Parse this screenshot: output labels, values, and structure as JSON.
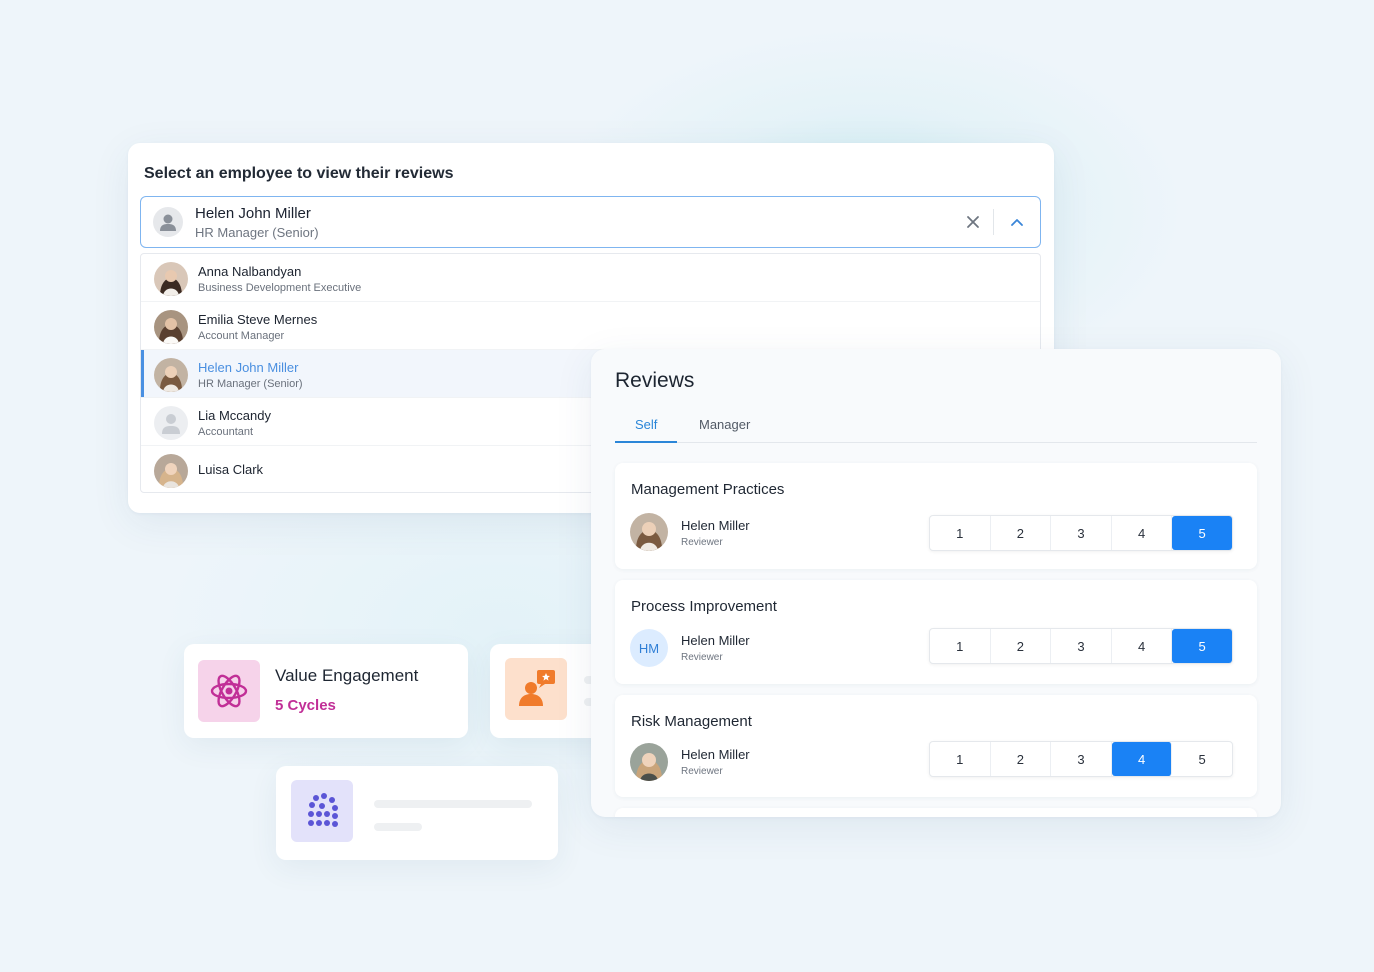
{
  "selector": {
    "title": "Select an employee to view their reviews",
    "selected": {
      "name": "Helen John Miller",
      "role": "HR Manager (Senior)"
    },
    "clear_icon": "close-icon",
    "toggle_icon": "chevron-up-icon",
    "options": [
      {
        "name": "Anna Nalbandyan",
        "role": "Business Development Executive",
        "active": false
      },
      {
        "name": "Emilia Steve Mernes",
        "role": "Account Manager",
        "active": false
      },
      {
        "name": "Helen John Miller",
        "role": "HR Manager (Senior)",
        "active": true
      },
      {
        "name": "Lia Mccandy",
        "role": "Accountant",
        "active": false
      },
      {
        "name": "Luisa Clark",
        "role": "",
        "active": false
      }
    ]
  },
  "reviews": {
    "title": "Reviews",
    "tabs": [
      {
        "label": "Self",
        "active": true
      },
      {
        "label": "Manager",
        "active": false
      }
    ],
    "items": [
      {
        "title": "Management Practices",
        "reviewer": "Helen Miller",
        "reviewer_role": "Reviewer",
        "avatar": "photo",
        "rating": 5
      },
      {
        "title": "Process Improvement",
        "reviewer": "Helen Miller",
        "reviewer_role": "Reviewer",
        "avatar": "HM",
        "rating": 5
      },
      {
        "title": "Risk Management",
        "reviewer": "Helen Miller",
        "reviewer_role": "Reviewer",
        "avatar": "photo",
        "rating": 4
      }
    ],
    "scale": [
      "1",
      "2",
      "3",
      "4",
      "5"
    ]
  },
  "value_engagement": {
    "title": "Value Engagement",
    "subtitle": "5 Cycles",
    "icon": "atom-icon"
  },
  "feedback_card": {
    "icon": "person-feedback-icon"
  },
  "bubbles_card": {
    "icon": "people-cluster-icon"
  },
  "colors": {
    "accent": "#1a82f5",
    "link": "#4a8fe0",
    "magenta": "#c12f97",
    "orange": "#f07b2b"
  }
}
